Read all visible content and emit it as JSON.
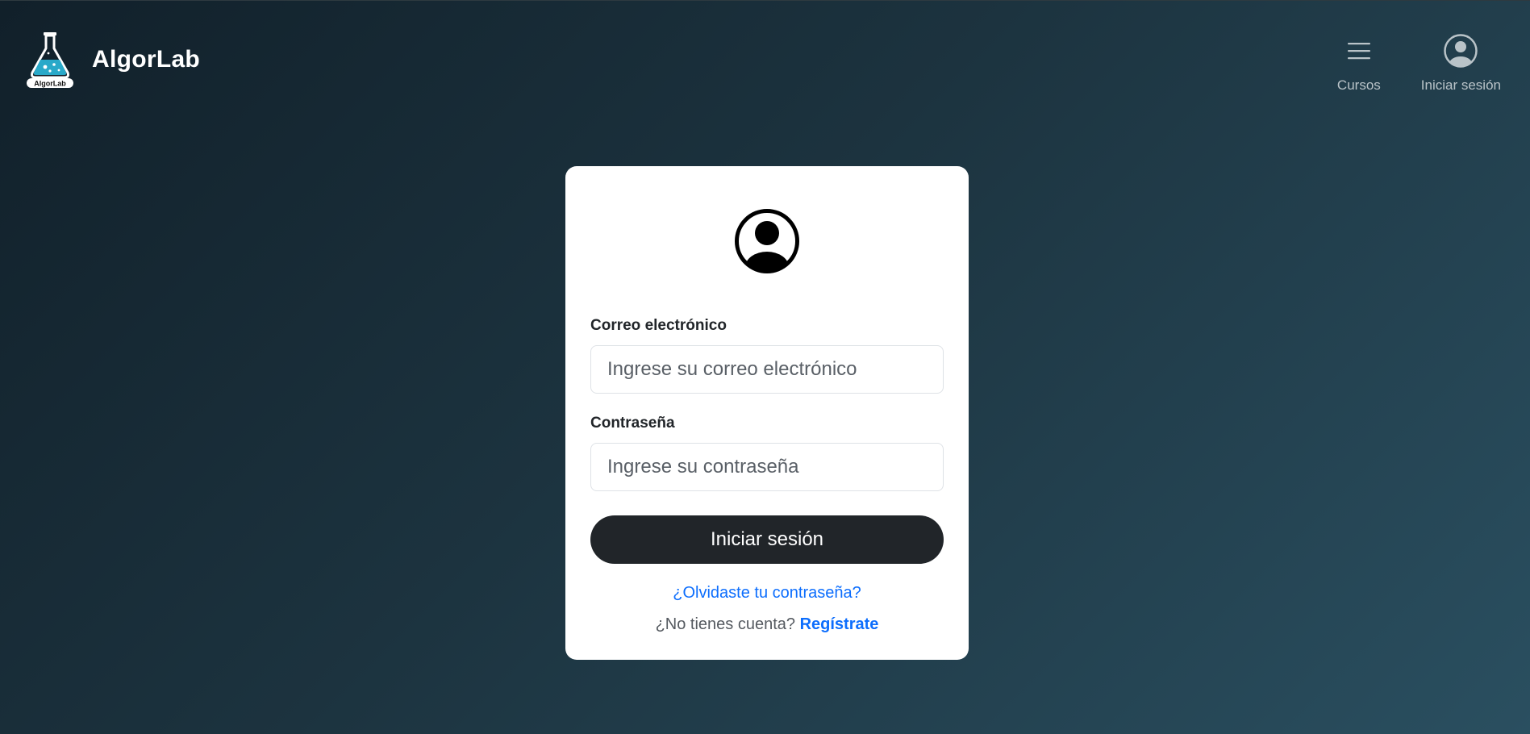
{
  "header": {
    "brand_name": "AlgorLab",
    "logo_text": "AlgorLab",
    "nav": {
      "courses_label": "Cursos",
      "login_label": "Iniciar sesión",
      "courses_icon": "menu-icon",
      "login_icon": "user-circle-icon"
    }
  },
  "login": {
    "avatar_icon": "user-circle-icon",
    "email_label": "Correo electrónico",
    "email_placeholder": "Ingrese su correo electrónico",
    "email_value": "",
    "password_label": "Contraseña",
    "password_placeholder": "Ingrese su contraseña",
    "password_value": "",
    "submit_label": "Iniciar sesión",
    "forgot_label": "¿Olvidaste tu contraseña?",
    "no_account_text": "¿No tienes cuenta?",
    "signup_label": "Regístrate"
  },
  "colors": {
    "background_start": "#11202a",
    "background_end": "#2a4f60",
    "card": "#ffffff",
    "button": "#212529",
    "link": "#0d6efd",
    "logo_accent": "#29a9c9"
  }
}
